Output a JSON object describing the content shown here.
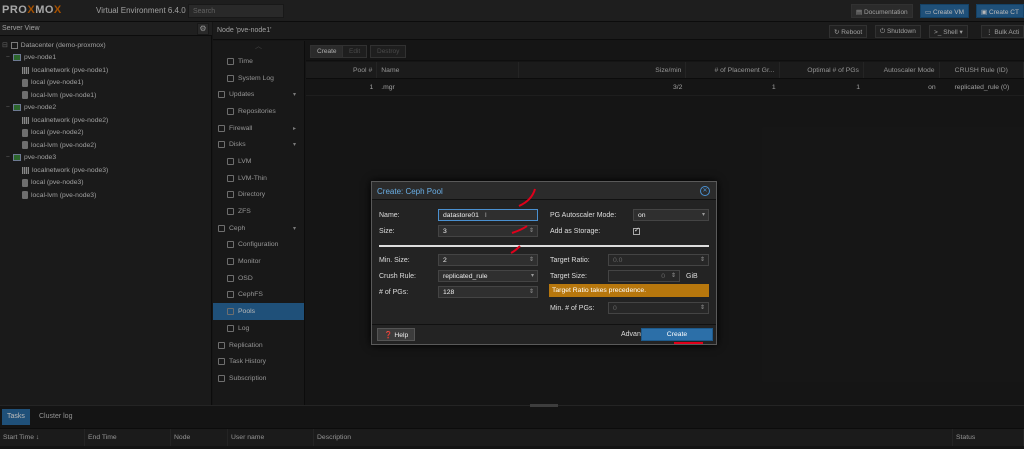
{
  "topbar": {
    "logo_a": "PRO",
    "logo_x": "X",
    "logo_b": "MO",
    "logo_c": "X",
    "version": "Virtual Environment 6.4.0",
    "search_placeholder": "Search",
    "documentation": "Documentation",
    "create_vm": "Create VM",
    "create_ct": "Create CT"
  },
  "sidebar": {
    "title": "Server View",
    "tree": [
      {
        "label": "Datacenter (demo-proxmox)",
        "icon": "datacenter-icon",
        "level": 0
      },
      {
        "label": "pve-node1",
        "icon": "node-icon",
        "level": 1
      },
      {
        "label": "localnetwork (pve-node1)",
        "icon": "network-icon",
        "level": 2
      },
      {
        "label": "local (pve-node1)",
        "icon": "storage-icon",
        "level": 2
      },
      {
        "label": "local-lvm (pve-node1)",
        "icon": "storage-icon",
        "level": 2
      },
      {
        "label": "pve-node2",
        "icon": "node-icon",
        "level": 1
      },
      {
        "label": "localnetwork (pve-node2)",
        "icon": "network-icon",
        "level": 2
      },
      {
        "label": "local (pve-node2)",
        "icon": "storage-icon",
        "level": 2
      },
      {
        "label": "local-lvm (pve-node2)",
        "icon": "storage-icon",
        "level": 2
      },
      {
        "label": "pve-node3",
        "icon": "node-icon",
        "level": 1
      },
      {
        "label": "localnetwork (pve-node3)",
        "icon": "network-icon",
        "level": 2
      },
      {
        "label": "local (pve-node3)",
        "icon": "storage-icon",
        "level": 2
      },
      {
        "label": "local-lvm (pve-node3)",
        "icon": "storage-icon",
        "level": 2
      }
    ]
  },
  "node_header": {
    "title": "Node 'pve-node1'",
    "reboot": "Reboot",
    "shutdown": "Shutdown",
    "shell": "Shell",
    "bulk": "Bulk Acti"
  },
  "menu": [
    {
      "label": "Time",
      "icon": "clock-icon",
      "level": 2
    },
    {
      "label": "System Log",
      "icon": "list-icon",
      "level": 2
    },
    {
      "label": "Updates",
      "icon": "refresh-icon",
      "level": 1,
      "arrow": "▾"
    },
    {
      "label": "Repositories",
      "icon": "repository-icon",
      "level": 2
    },
    {
      "label": "Firewall",
      "icon": "shield-icon",
      "level": 1,
      "arrow": "▸"
    },
    {
      "label": "Disks",
      "icon": "disk-icon",
      "level": 1,
      "arrow": "▾"
    },
    {
      "label": "LVM",
      "icon": "lvm-icon",
      "level": 2
    },
    {
      "label": "LVM-Thin",
      "icon": "lvm-thin-icon",
      "level": 2
    },
    {
      "label": "Directory",
      "icon": "folder-icon",
      "level": 2
    },
    {
      "label": "ZFS",
      "icon": "zfs-icon",
      "level": 2
    },
    {
      "label": "Ceph",
      "icon": "ceph-icon",
      "level": 1,
      "arrow": "▾"
    },
    {
      "label": "Configuration",
      "icon": "gear-icon",
      "level": 2
    },
    {
      "label": "Monitor",
      "icon": "monitor-icon",
      "level": 2
    },
    {
      "label": "OSD",
      "icon": "osd-icon",
      "level": 2
    },
    {
      "label": "CephFS",
      "icon": "folder-icon",
      "level": 2
    },
    {
      "label": "Pools",
      "icon": "sitemap-icon",
      "level": 2,
      "selected": true
    },
    {
      "label": "Log",
      "icon": "list-icon",
      "level": 2
    },
    {
      "label": "Replication",
      "icon": "replication-icon",
      "level": 1
    },
    {
      "label": "Task History",
      "icon": "list-icon",
      "level": 1
    },
    {
      "label": "Subscription",
      "icon": "support-icon",
      "level": 1
    }
  ],
  "pool_toolbar": {
    "create": "Create",
    "edit": "Edit",
    "destroy": "Destroy"
  },
  "pool_grid": {
    "columns": [
      "Pool #",
      "Name",
      "Size/min",
      "# of Placement Gr...",
      "Optimal # of PGs",
      "Autoscaler Mode",
      "CRUSH Rule (ID)"
    ],
    "rows": [
      [
        "1",
        ".mgr",
        "3/2",
        "1",
        "1",
        "on",
        "replicated_rule (0)"
      ]
    ]
  },
  "bottom": {
    "tab_tasks": "Tasks",
    "tab_cluster": "Cluster log",
    "columns": [
      "Start Time ↓",
      "End Time",
      "Node",
      "User name",
      "Description",
      "Status"
    ]
  },
  "dialog": {
    "title": "Create: Ceph Pool",
    "name_label": "Name:",
    "name_value": "datastore01",
    "size_label": "Size:",
    "size_value": "3",
    "min_size_label": "Min. Size:",
    "min_size_value": "2",
    "crush_label": "Crush Rule:",
    "crush_value": "replicated_rule",
    "pgs_label": "# of PGs:",
    "pgs_value": "128",
    "autoscaler_label": "PG Autoscaler Mode:",
    "autoscaler_value": "on",
    "add_storage_label": "Add as Storage:",
    "target_ratio_label": "Target Ratio:",
    "target_ratio_value": "0.0",
    "target_size_label": "Target Size:",
    "target_size_value": "0",
    "target_size_unit": "GiB",
    "warning": "Target Ratio takes precedence.",
    "min_pgs_label": "Min. # of PGs:",
    "min_pgs_value": "0",
    "help": "Help",
    "advanced": "Advanced",
    "create": "Create"
  },
  "colors": {
    "accent": "#2c6fa8",
    "warning": "#b7770d",
    "annotation": "#e0001b"
  }
}
